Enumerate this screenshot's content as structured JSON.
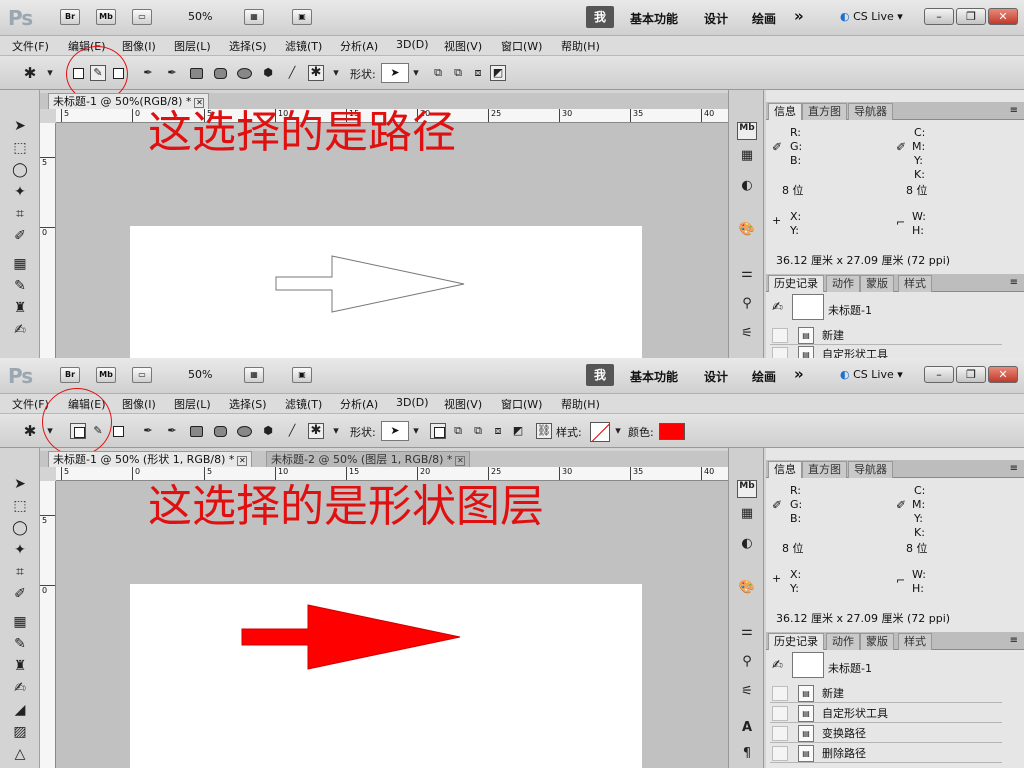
{
  "app_bar": {
    "logo": "Ps",
    "br_label": "Br",
    "mb_label": "Mb",
    "zoom": "50%",
    "workspace_me": "我",
    "workspace_basic": "基本功能",
    "workspace_design": "设计",
    "workspace_painting": "绘画",
    "more": "»",
    "cs_live": "CS Live"
  },
  "menu": [
    "文件(F)",
    "编辑(E)",
    "图像(I)",
    "图层(L)",
    "选择(S)",
    "滤镜(T)",
    "分析(A)",
    "3D(D)",
    "视图(V)",
    "窗口(W)",
    "帮助(H)"
  ],
  "options_bar": {
    "shape_label": "形状:",
    "style_label": "样式:",
    "color_label": "颜色:",
    "color_value": "#ff0000"
  },
  "top": {
    "tabs": [
      {
        "label": "未标题-1 @ 50%(RGB/8) *"
      }
    ],
    "ruler_labels": [
      "5",
      "0",
      "5",
      "10",
      "15",
      "20",
      "25",
      "30",
      "35",
      "40"
    ],
    "vruler_labels": [
      "5",
      "0"
    ],
    "annotation": "这选择的是路径",
    "arrow_style": "outline path"
  },
  "bottom": {
    "tabs": [
      {
        "label": "未标题-1 @ 50% (形状 1, RGB/8) *"
      },
      {
        "label": "未标题-2 @ 50% (图层 1, RGB/8) *"
      }
    ],
    "ruler_labels": [
      "5",
      "0",
      "5",
      "10",
      "15",
      "20",
      "25",
      "30",
      "35",
      "40"
    ],
    "vruler_labels": [
      "5",
      "0"
    ],
    "annotation": "这选择的是形状图层",
    "arrow_style": "filled red shape layer"
  },
  "panels": {
    "info_tabs": [
      "信息",
      "直方图",
      "导航器"
    ],
    "info": {
      "r": "R:",
      "g": "G:",
      "b": "B:",
      "c": "C:",
      "m": "M:",
      "y": "Y:",
      "k": "K:",
      "bits_left": "8 位",
      "bits_right": "8 位",
      "x": "X:",
      "yy": "Y:",
      "w": "W:",
      "h": "H:",
      "doc_size": "36.12 厘米 x 27.09 厘米 (72 ppi)"
    },
    "history_tabs": [
      "历史记录",
      "动作",
      "蒙版",
      "样式"
    ],
    "snapshot": "未标题-1",
    "history_top": [
      "新建",
      "自定形状工具"
    ],
    "history_bottom": [
      "新建",
      "自定形状工具",
      "变换路径",
      "删除路径"
    ]
  }
}
